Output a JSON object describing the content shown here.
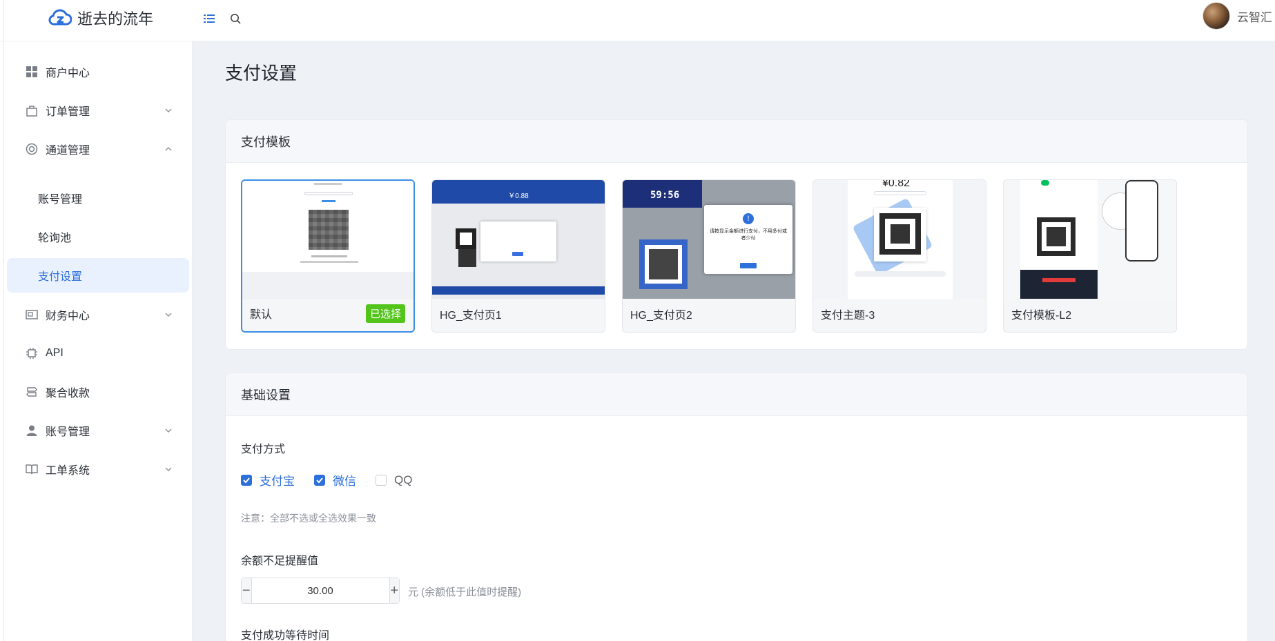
{
  "brand": {
    "name": "逝去的流年"
  },
  "user": {
    "name": "云智汇"
  },
  "sidebar": {
    "items": [
      {
        "label": "商户中心"
      },
      {
        "label": "订单管理"
      },
      {
        "label": "通道管理"
      },
      {
        "label": "财务中心"
      },
      {
        "label": "API"
      },
      {
        "label": "聚合收款"
      },
      {
        "label": "账号管理"
      },
      {
        "label": "工单系统"
      }
    ],
    "sub_items": [
      {
        "label": "账号管理"
      },
      {
        "label": "轮询池"
      },
      {
        "label": "支付设置"
      }
    ]
  },
  "page": {
    "title": "支付设置"
  },
  "template_card": {
    "title": "支付模板",
    "templates": [
      {
        "name": "默认",
        "badge": "已选择"
      },
      {
        "name": "HG_支付页1"
      },
      {
        "name": "HG_支付页2"
      },
      {
        "name": "支付主题-3"
      },
      {
        "name": "支付模板-L2"
      }
    ],
    "preview_text": {
      "tpl2_price": "￥0.88",
      "tpl3_timer": "59:56",
      "tpl3_alert": "请按显示金额进行支付，不用多付或者少付",
      "tpl4_price": "¥0.82"
    }
  },
  "basic_card": {
    "title": "基础设置",
    "payment_method_label": "支付方式",
    "methods": [
      {
        "label": "支付宝",
        "checked": true
      },
      {
        "label": "微信",
        "checked": true
      },
      {
        "label": "QQ",
        "checked": false
      }
    ],
    "note": "注意：全部不选或全选效果一致",
    "balance_label": "余额不足提醒值",
    "balance_value": "30.00",
    "balance_unit_hint": "元 (余额低于此值时提醒)",
    "wait_time_label": "支付成功等待时间"
  },
  "colors": {
    "accent": "#2d6fdb",
    "selected_badge": "#52c41a",
    "active_bg": "#e8f1fd"
  }
}
